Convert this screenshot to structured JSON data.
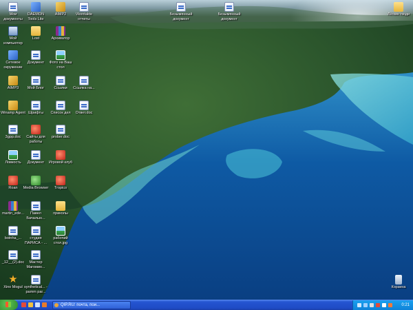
{
  "desktop": {
    "icons": [
      {
        "label": "Мои документы",
        "icon": "my-documents-icon"
      },
      {
        "label": "DAEMON Tools Lite",
        "icon": "daemon-tools-icon"
      },
      {
        "label": "AIMP2",
        "icon": "aimp-icon"
      },
      {
        "label": "Vkontakte отчеты",
        "icon": "document-icon"
      },
      {
        "label": "Безымянный документ",
        "icon": "document-icon"
      },
      {
        "label": "Безымянный документ",
        "icon": "document-icon"
      },
      {
        "label": "Лёгкие люди",
        "icon": "folder-icon"
      },
      {
        "label": "Мой компьютер",
        "icon": "my-computer-icon"
      },
      {
        "label": "Lost",
        "icon": "folder-icon"
      },
      {
        "label": "Архиватор",
        "icon": "archive-icon"
      },
      {
        "label": "Сетевое окружение",
        "icon": "network-icon"
      },
      {
        "label": "Документ",
        "icon": "document-icon"
      },
      {
        "label": "Фото на Ваш стол",
        "icon": "image-icon"
      },
      {
        "label": "AIMP3",
        "icon": "aimp-icon"
      },
      {
        "label": "Мой Блог",
        "icon": "document-icon"
      },
      {
        "label": "Ссылки",
        "icon": "document-icon"
      },
      {
        "label": "Ссылка на...",
        "icon": "document-icon"
      },
      {
        "label": "Winamp Agent",
        "icon": "media-icon"
      },
      {
        "label": "Шрифты",
        "icon": "document-icon"
      },
      {
        "label": "Список дел",
        "icon": "document-icon"
      },
      {
        "label": "Ответ.doc",
        "icon": "document-icon"
      },
      {
        "label": "3gpp.doc",
        "icon": "document-icon"
      },
      {
        "label": "Сайты для работы",
        "icon": "red-app-icon"
      },
      {
        "label": "prober.doc",
        "icon": "document-icon"
      },
      {
        "label": "Ловкость",
        "icon": "image-icon"
      },
      {
        "label": "Документ",
        "icon": "document-icon"
      },
      {
        "label": "Игровой клуб",
        "icon": "red-app-icon"
      },
      {
        "label": "Roan",
        "icon": "red-app-icon"
      },
      {
        "label": "Media Browser",
        "icon": "green-app-icon"
      },
      {
        "label": "Tropico",
        "icon": "red-app-icon"
      },
      {
        "label": "martin_ede...",
        "icon": "archive-icon"
      },
      {
        "label": "Павел Бачалын...",
        "icon": "document-icon"
      },
      {
        "label": "приколы",
        "icon": "folder-icon"
      },
      {
        "label": "botnha_...",
        "icon": "document-icon"
      },
      {
        "label": "студия ПАРИСА - ...",
        "icon": "document-icon"
      },
      {
        "label": "рабочий стол.jpg",
        "icon": "image-icon"
      },
      {
        "label": "_12__(2).doc",
        "icon": "document-icon"
      },
      {
        "label": "Мастер Магомин...",
        "icon": "document-icon"
      },
      {
        "label": "Xino Mogul",
        "icon": "star-app-icon"
      },
      {
        "label": "synthetical... - pamm par...",
        "icon": "document-icon"
      },
      {
        "label": "Корзина",
        "icon": "recycle-bin-icon"
      }
    ]
  },
  "taskbar": {
    "task_label": "QIP.RU: почта, пои...",
    "clock": "0:21"
  },
  "colors": {
    "taskbar_blue": "#2454d0",
    "tray_blue": "#0f82d8",
    "start_green": "#3a9c35"
  }
}
